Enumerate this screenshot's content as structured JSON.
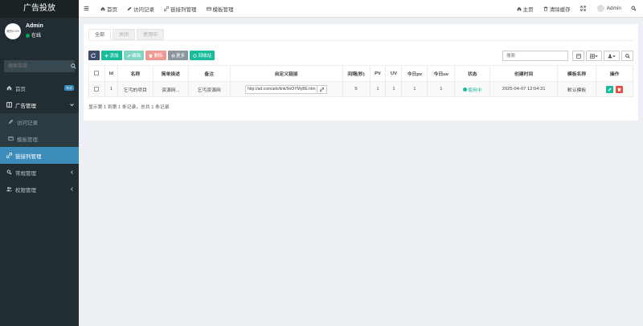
{
  "app": {
    "title": "广告投放"
  },
  "user": {
    "name": "Admin",
    "status": "在线",
    "avatar_text": "我的ICON"
  },
  "sidebar": {
    "search_placeholder": "搜索菜单",
    "items": [
      {
        "label": "首页",
        "badge": "hot",
        "icon": "home-icon"
      },
      {
        "label": "广告管理",
        "icon": "grid-icon"
      },
      {
        "label": "访问记录",
        "icon": "pencil-icon"
      },
      {
        "label": "模板管理",
        "icon": "window-icon"
      },
      {
        "label": "链接列管理",
        "icon": "link-icon"
      },
      {
        "label": "常规管理",
        "icon": "cogs-icon"
      },
      {
        "label": "权限管理",
        "icon": "users-icon"
      }
    ]
  },
  "header": {
    "tabs": [
      {
        "label": "首页"
      },
      {
        "label": "访问记录"
      },
      {
        "label": "链接列管理"
      },
      {
        "label": "模板管理"
      }
    ],
    "right": [
      {
        "label": "主页"
      },
      {
        "label": "清除缓存"
      },
      {
        "label": "Admin"
      }
    ]
  },
  "content": {
    "filter_tabs": [
      "全部",
      "关闭",
      "使用中"
    ],
    "toolbar": {
      "add": "添加",
      "edit": "编辑",
      "delete": "删除",
      "more": "更多",
      "recycle": "回收站"
    },
    "search_placeholder": "搜索",
    "columns": [
      "Id",
      "名称",
      "简单描述",
      "备注",
      "自定义链接",
      "间隔(秒)",
      "PV",
      "UV",
      "今日pv",
      "今日uv",
      "状态",
      "创建时间",
      "模板名称",
      "操作"
    ],
    "rows": [
      {
        "id": "1",
        "name": "乞丐的项目",
        "desc": "资源网...",
        "remark": "乞丐资源网",
        "link": "http://ad.com/ads/link/9oOYMyBE.htm",
        "interval": "5",
        "pv": "1",
        "uv": "1",
        "today_pv": "1",
        "today_uv": "1",
        "status": "使用中",
        "created": "2025-04-07 12:04:31",
        "template": "默认模板"
      }
    ],
    "pager": "显示第 1 到第 1 条记录，总共 1 条记录"
  },
  "colors": {
    "sidebar": "#222d32",
    "accent": "#3c8dbc",
    "success": "#18bc9c",
    "danger": "#e74c3c"
  }
}
